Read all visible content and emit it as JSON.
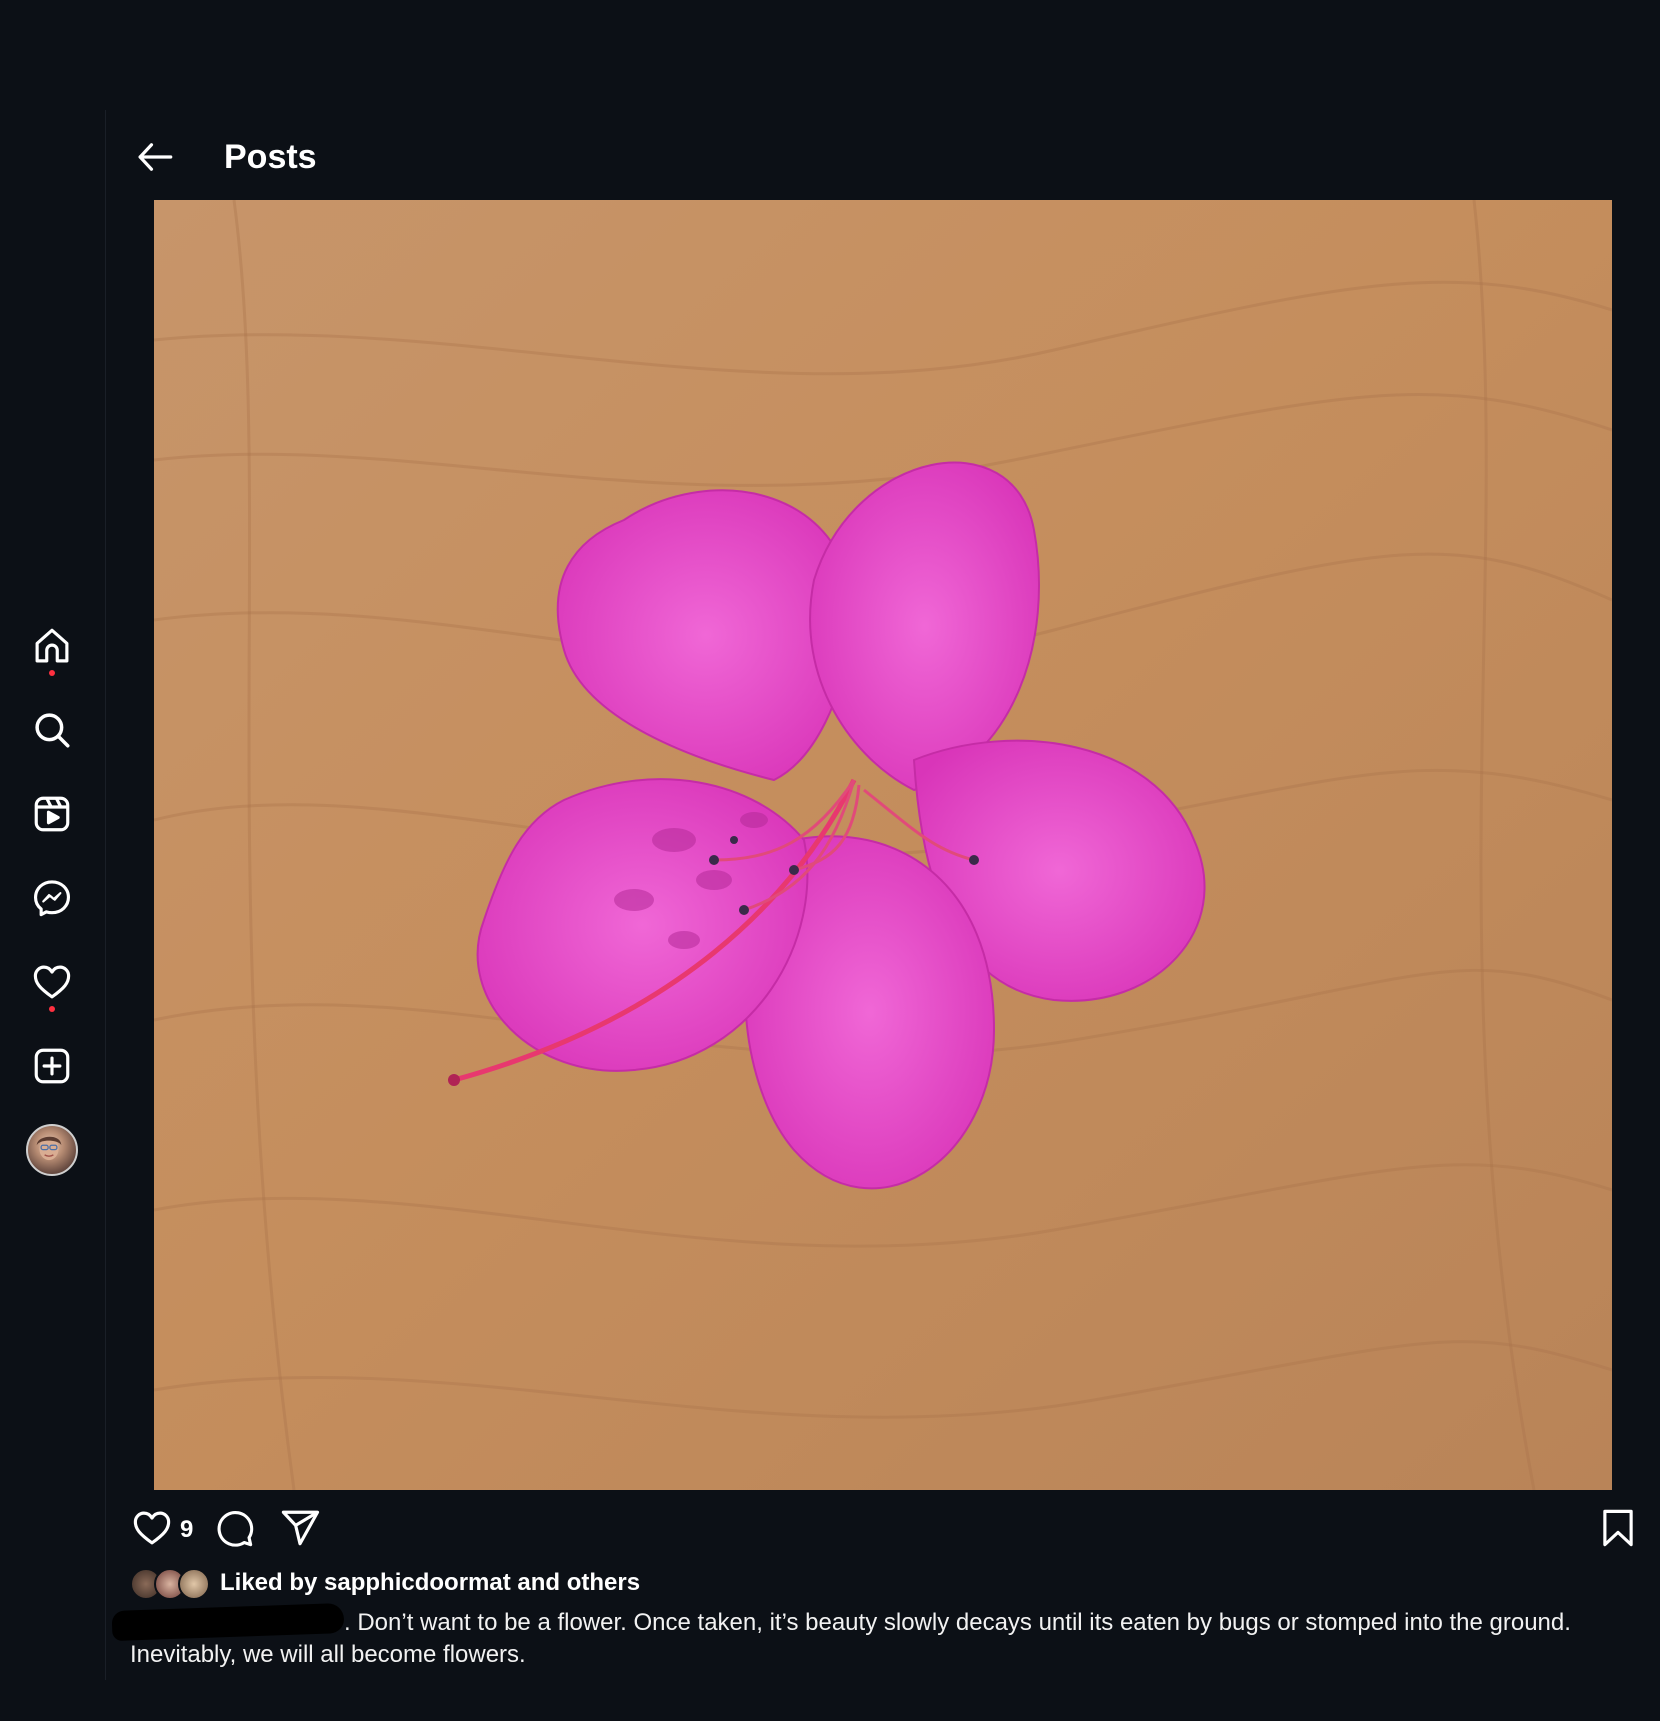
{
  "header": {
    "title": "Posts"
  },
  "post": {
    "like_count": "9",
    "likes_text": "Liked by sapphicdoormat and others",
    "caption_line1": ". Don’t want to be a flower. Once taken, it’s beauty slowly decays until its eaten by bugs or stomped into the ground.",
    "caption_line2": "Inevitably, we will all become flowers."
  },
  "nav": {
    "items": [
      "home-icon",
      "search-icon",
      "reels-icon",
      "messenger-icon",
      "heart-icon",
      "create-icon",
      "profile-avatar"
    ]
  },
  "colors": {
    "background": "#0c1016",
    "text": "#ffffff",
    "notification": "#ff3040",
    "flower": "#e23fc4",
    "wood": "#c08a5a"
  }
}
